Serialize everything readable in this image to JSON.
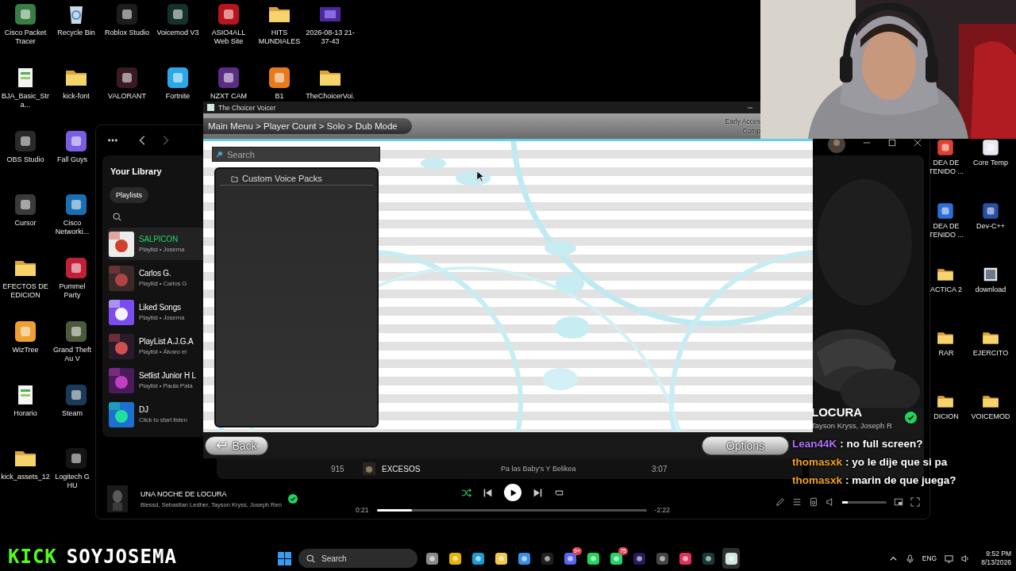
{
  "desktop": {
    "left_rows": [
      [
        {
          "label": "Cisco Packet Tracer",
          "kind": "app",
          "color": "#3a7d44"
        },
        {
          "label": "Recycle Bin",
          "kind": "bin"
        },
        {
          "label": "Roblox Studio",
          "kind": "app",
          "color": "#1c1c1c"
        },
        {
          "label": "Voicemod V3",
          "kind": "app",
          "color": "#16302c"
        },
        {
          "label": "ASIO4ALL Web Site",
          "kind": "app",
          "color": "#b8141c"
        },
        {
          "label": "HITS MUNDIALES",
          "kind": "folder"
        },
        {
          "label": "2026-08-13 21-37-43",
          "kind": "video"
        }
      ],
      [
        {
          "label": "BJA_Basic_Stra...",
          "kind": "file"
        },
        {
          "label": "kick-font",
          "kind": "folder"
        },
        {
          "label": "VALORANT",
          "kind": "app",
          "color": "#3a1a22"
        },
        {
          "label": "Fortnite",
          "kind": "app",
          "color": "#2aa8e8"
        },
        {
          "label": "NZXT CAM",
          "kind": "app",
          "color": "#5b2c86"
        },
        {
          "label": "B1",
          "kind": "app",
          "color": "#e87a1c"
        },
        {
          "label": "TheChoicerVoi...",
          "kind": "folder"
        }
      ],
      [
        {
          "label": "OBS Studio",
          "kind": "app",
          "color": "#2a2a2a"
        },
        {
          "label": "Fall Guys",
          "kind": "app",
          "color": "#7b5de0"
        }
      ],
      [
        {
          "label": "Cursor",
          "kind": "app",
          "color": "#3a3a3a"
        },
        {
          "label": "Cisco Networki...",
          "kind": "app",
          "color": "#1a6fb3"
        }
      ],
      [
        {
          "label": "EFECTOS DE EDICION",
          "kind": "folder"
        },
        {
          "label": "Pummel Party",
          "kind": "app",
          "color": "#c0203a"
        }
      ],
      [
        {
          "label": "WizTree",
          "kind": "app",
          "color": "#f0a030"
        },
        {
          "label": "Grand Theft Au V",
          "kind": "app",
          "color": "#4a5a3a"
        }
      ],
      [
        {
          "label": "Horario",
          "kind": "file"
        },
        {
          "label": "Steam",
          "kind": "app",
          "color": "#1b3a5a"
        }
      ],
      [
        {
          "label": "kick_assets_12",
          "kind": "folder"
        },
        {
          "label": "Logitech G HU",
          "kind": "app",
          "color": "#151515"
        }
      ]
    ],
    "right_rows": [
      [
        {
          "label": "DEA DE TENIDO ...",
          "kind": "app",
          "color": "#e04030"
        },
        {
          "label": "Core Temp",
          "kind": "app",
          "color": "#e8e8f0"
        }
      ],
      [
        {
          "label": "DEA DE TENIDO ...",
          "kind": "app",
          "color": "#2b6fd6"
        },
        {
          "label": "Dev-C++",
          "kind": "app",
          "color": "#2a4fa0"
        }
      ],
      [
        {
          "label": "ACTICA 2",
          "kind": "folder"
        },
        {
          "label": "download",
          "kind": "file"
        }
      ],
      [
        {
          "label": "RAR",
          "kind": "folder"
        },
        {
          "label": "EJERCITO",
          "kind": "folder"
        }
      ],
      [
        {
          "label": "DICION",
          "kind": "folder"
        },
        {
          "label": "VOICEMOD",
          "kind": "folder"
        }
      ]
    ]
  },
  "spotify": {
    "library": {
      "title": "Your Library",
      "filter": "Playlists",
      "items": [
        {
          "title": "SALPICON",
          "subtitle": "Playlist • Josema",
          "selected": true
        },
        {
          "title": "Carlos G.",
          "subtitle": "Playlist • Carlos G",
          "selected": false
        },
        {
          "title": "Liked Songs",
          "subtitle": "Playlist • Josema",
          "selected": false
        },
        {
          "title": "PlayList A.J.G.A",
          "subtitle": "Playlist • Álvaro el",
          "selected": false
        },
        {
          "title": "Setlist Junior H L",
          "subtitle": "Playlist • Paula Pata",
          "selected": false
        },
        {
          "title": "DJ",
          "subtitle": "Click to start listen",
          "selected": false
        }
      ]
    },
    "track_row": {
      "number": "915",
      "title": "EXCESOS",
      "album": "Pa las Baby's Y Belikea",
      "duration": "3:07"
    },
    "now_playing": {
      "title": "LOCURA",
      "artists": "Tayson Kryss, Joseph R"
    },
    "player": {
      "title": "UNA NOCHE DE LOCURA",
      "artists": "Blessd, Sebastian Ledher, Tayson Kryss, Joseph Ren",
      "shuffle_on": true,
      "elapsed": "0:21",
      "remaining": "-2:22",
      "progress": {
        "level": 0.13
      },
      "volume": {
        "level": 0.12
      }
    }
  },
  "choicer": {
    "window_title": "The Choicer Voicer",
    "breadcrumb": "Main Menu > Player Count > Solo > Dub Mode",
    "notice": [
      "Early Acces",
      "Comp"
    ],
    "search": {
      "placeholder": "Search"
    },
    "items": [
      {
        "label": "Custom Voice Packs",
        "kind": "folder"
      }
    ],
    "buttons": [
      {
        "label": "Back",
        "kind": "back"
      },
      {
        "label": "Options",
        "kind": "options"
      }
    ]
  },
  "chat": [
    {
      "user": "Lean44K",
      "color": "#b070ff",
      "message": ": no full screen?"
    },
    {
      "user": "thomasxk",
      "color": "#f0a020",
      "message": ": yo le dije que si pa"
    },
    {
      "user": "thomasxk",
      "color": "#f0a020",
      "message": ": marin de que juega?"
    }
  ],
  "stream_logo": {
    "brand": "KICK",
    "channel": "SOYJOSEMA"
  },
  "taskbar": {
    "search": {
      "placeholder": "Search"
    },
    "apps": [
      {
        "color": "#8a8a8a",
        "selected": false
      },
      {
        "color": "#e8b400",
        "selected": false
      },
      {
        "color": "#1f9ad6",
        "selected": false
      },
      {
        "color": "#f2c94c",
        "selected": false
      },
      {
        "color": "#3a8ee6",
        "selected": false
      },
      {
        "color": "#202020",
        "selected": false
      },
      {
        "color": "#5865f2",
        "badge": "9+",
        "selected": false
      },
      {
        "color": "#1ed760",
        "selected": false
      },
      {
        "color": "#25d366",
        "badge": "75",
        "selected": false
      },
      {
        "color": "#2a1a5e",
        "selected": false
      },
      {
        "color": "#444444",
        "selected": false
      },
      {
        "color": "#e0305a",
        "selected": false
      },
      {
        "color": "#1a3a3a",
        "selected": false
      },
      {
        "color": "#cfe8e0",
        "selected": true
      }
    ],
    "tray": {
      "language": "ENG",
      "time": "9:52 PM",
      "date": "8/13/2026"
    }
  }
}
